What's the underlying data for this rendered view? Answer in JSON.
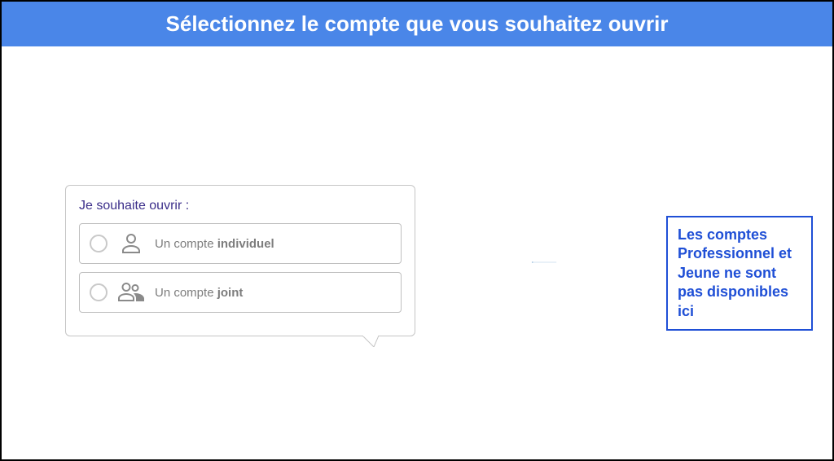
{
  "header": {
    "title": "Sélectionnez le compte que vous souhaitez ouvrir"
  },
  "card": {
    "label": "Je souhaite ouvrir :",
    "options": [
      {
        "prefix": "Un compte ",
        "bold": "individuel"
      },
      {
        "prefix": "Un compte ",
        "bold": "joint"
      }
    ]
  },
  "callout": {
    "text": "Les comptes Professionnel et Jeune ne sont pas disponibles ici"
  }
}
